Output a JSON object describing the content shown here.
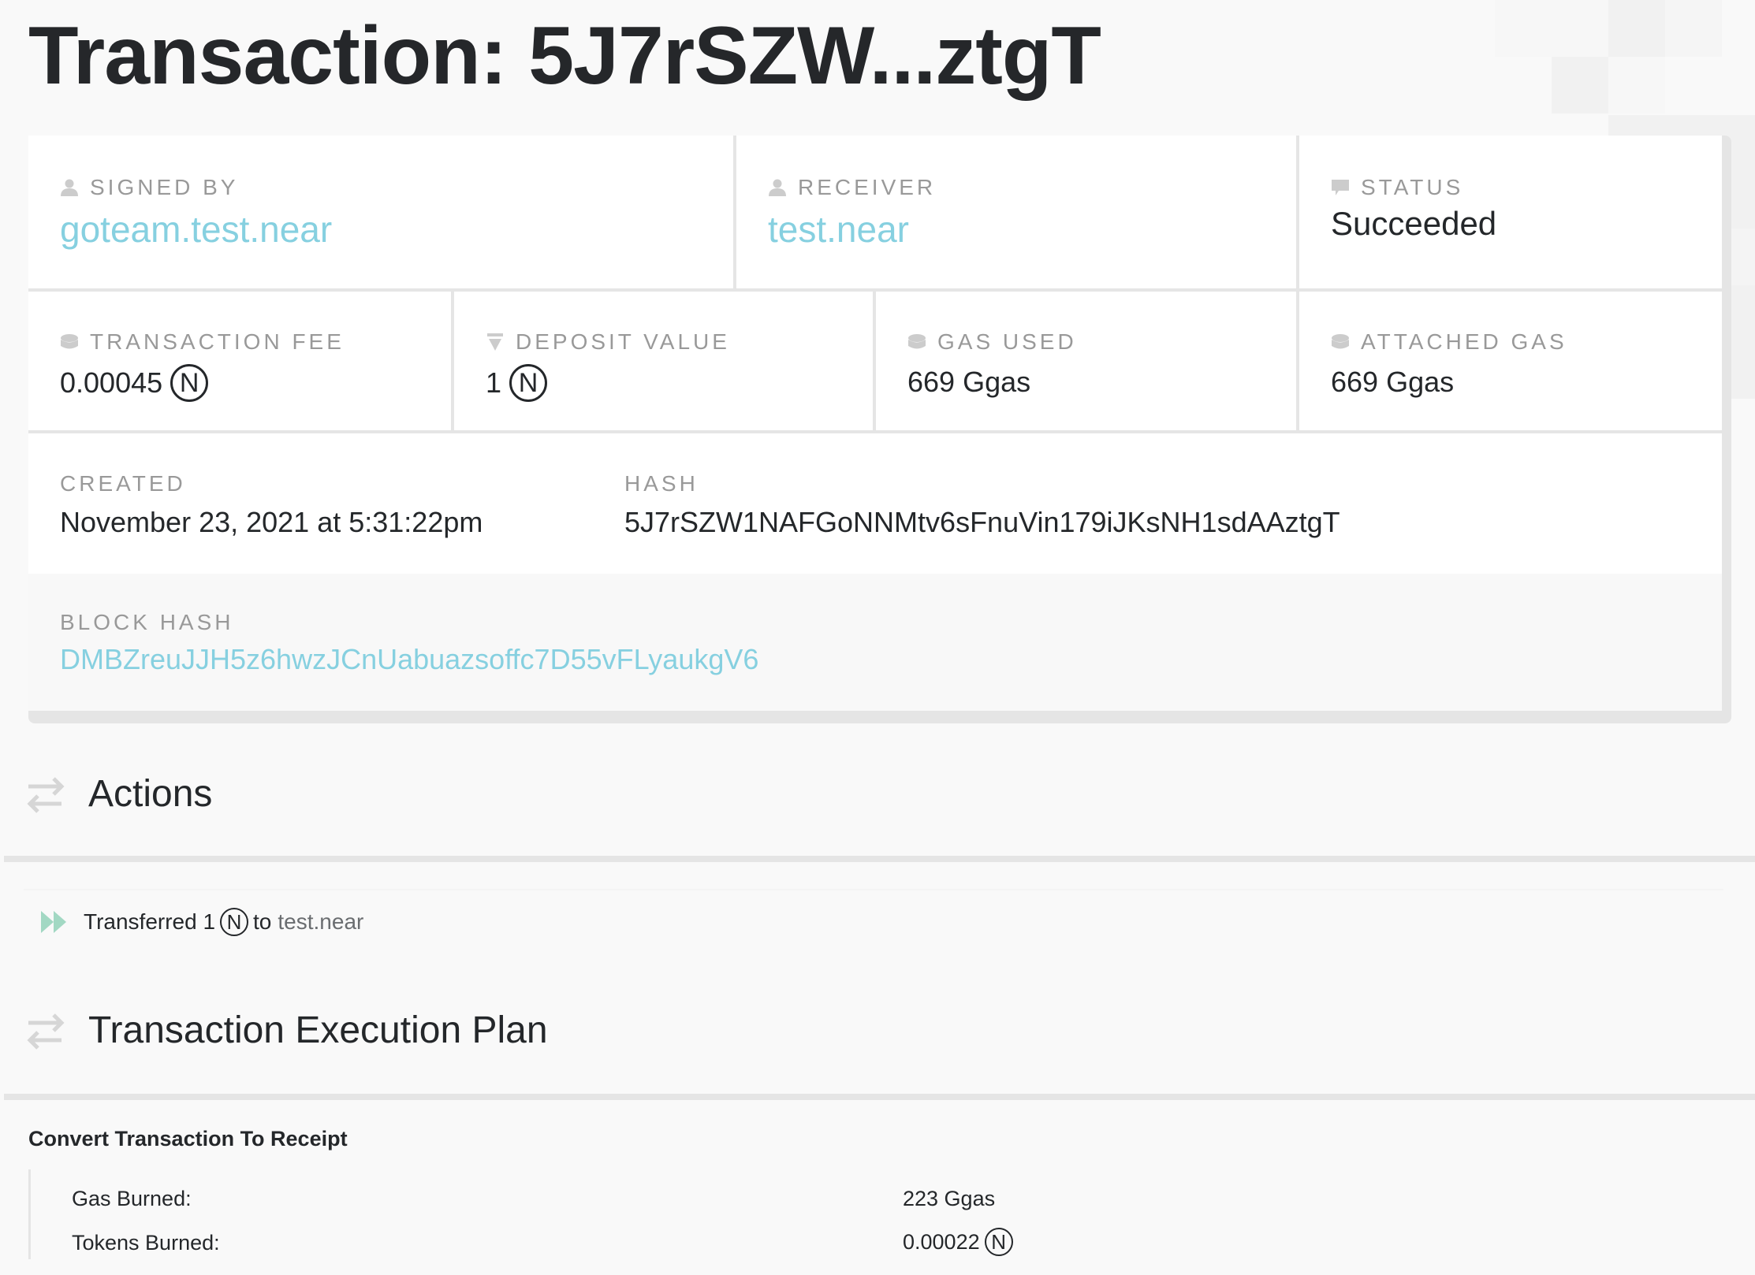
{
  "page": {
    "title": "Transaction: 5J7rSZW...ztgT"
  },
  "summary": {
    "signed_by": {
      "label": "Signed by",
      "value": "goteam.test.near",
      "icon": "user-icon"
    },
    "receiver": {
      "label": "Receiver",
      "value": "test.near",
      "icon": "user-icon"
    },
    "status": {
      "label": "Status",
      "value": "Succeeded",
      "icon": "speech-bubble-icon"
    },
    "transaction_fee": {
      "label": "Transaction Fee",
      "value": "0.00045",
      "unit_icon": "near-token-icon",
      "icon": "coin-stack-icon"
    },
    "deposit_value": {
      "label": "Deposit Value",
      "value": "1",
      "unit_icon": "near-token-icon",
      "icon": "deposit-funnel-icon"
    },
    "gas_used": {
      "label": "Gas Used",
      "value": "669 Ggas",
      "icon": "coin-stack-icon"
    },
    "attached_gas": {
      "label": "Attached Gas",
      "value": "669 Ggas",
      "icon": "coin-stack-icon"
    },
    "created": {
      "label": "Created",
      "value": "November 23, 2021 at 5:31:22pm"
    },
    "hash": {
      "label": "Hash",
      "value": "5J7rSZW1NAFGoNNMtv6sFnuVin179iJKsNH1sdAAztgT"
    },
    "block_hash": {
      "label": "Block Hash",
      "value": "DMBZreuJJH5z6hwzJCnUabuazsoffc7D55vFLyaukgV6"
    }
  },
  "near_symbol": "N",
  "actions": {
    "heading": "Actions",
    "items": [
      {
        "prefix": "Transferred 1",
        "unit_icon": "near-token-icon",
        "to": "to",
        "account": "test.near"
      }
    ]
  },
  "execution_plan": {
    "heading": "Transaction Execution Plan",
    "step_title": "Convert Transaction To Receipt",
    "rows": [
      {
        "key": "Gas Burned:",
        "value": "223 Ggas"
      },
      {
        "key": "Tokens Burned:",
        "value": "0.00022",
        "unit_icon": "near-token-icon"
      }
    ]
  },
  "colors": {
    "link": "#86d0e0",
    "label": "#999999",
    "text": "#24272a",
    "border": "#e5e5e5",
    "action_icon": "#a2d8c3"
  }
}
